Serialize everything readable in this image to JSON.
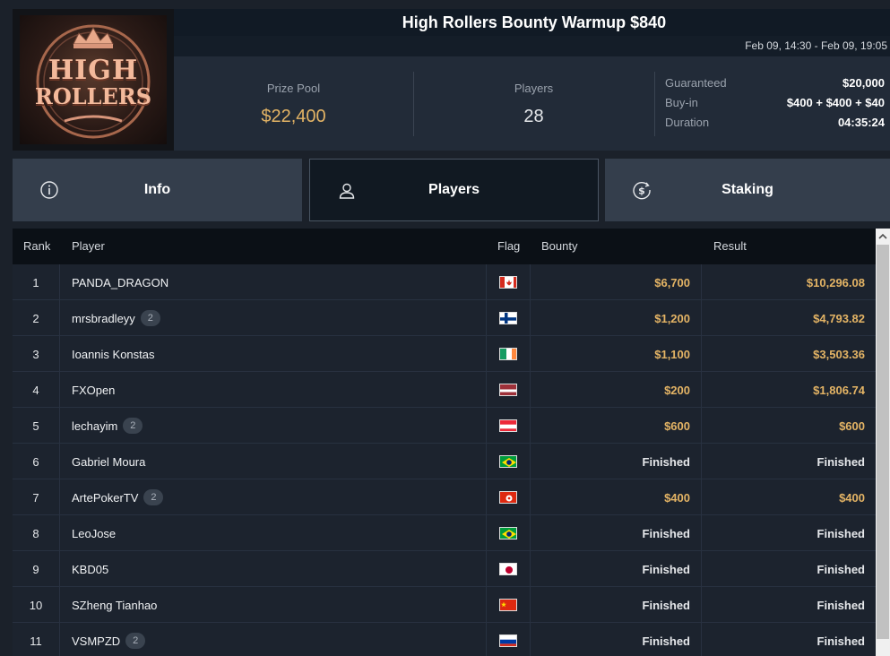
{
  "header": {
    "title": "High Rollers Bounty Warmup $840",
    "dates": "Feb 09, 14:30 - Feb 09, 19:05",
    "logo_text_line1": "HIGH",
    "logo_text_line2": "ROLLERS"
  },
  "stats": {
    "prize_pool_label": "Prize Pool",
    "prize_pool_value": "$22,400",
    "players_label": "Players",
    "players_value": "28",
    "guaranteed_label": "Guaranteed",
    "guaranteed_value": "$20,000",
    "buyin_label": "Buy-in",
    "buyin_value": "$400 + $400 + $40",
    "duration_label": "Duration",
    "duration_value": "04:35:24"
  },
  "tabs": [
    {
      "label": "Info",
      "icon": "info-icon"
    },
    {
      "label": "Players",
      "icon": "user-icon"
    },
    {
      "label": "Staking",
      "icon": "dollar-icon"
    }
  ],
  "table": {
    "headers": {
      "rank": "Rank",
      "player": "Player",
      "flag": "Flag",
      "bounty": "Bounty",
      "result": "Result"
    },
    "rows": [
      {
        "rank": "1",
        "player": "PANDA_DRAGON",
        "badge": "",
        "flag": "canada",
        "bounty": "$6,700",
        "result": "$10,296.08"
      },
      {
        "rank": "2",
        "player": "mrsbradleyy",
        "badge": "2",
        "flag": "finland",
        "bounty": "$1,200",
        "result": "$4,793.82"
      },
      {
        "rank": "3",
        "player": "Ioannis Konstas",
        "badge": "",
        "flag": "ireland",
        "bounty": "$1,100",
        "result": "$3,503.36"
      },
      {
        "rank": "4",
        "player": "FXOpen",
        "badge": "",
        "flag": "latvia",
        "bounty": "$200",
        "result": "$1,806.74"
      },
      {
        "rank": "5",
        "player": "lechayim",
        "badge": "2",
        "flag": "austria",
        "bounty": "$600",
        "result": "$600"
      },
      {
        "rank": "6",
        "player": "Gabriel Moura",
        "badge": "",
        "flag": "brazil",
        "bounty": "Finished",
        "result": "Finished"
      },
      {
        "rank": "7",
        "player": "ArtePokerTV",
        "badge": "2",
        "flag": "hongkong",
        "bounty": "$400",
        "result": "$400"
      },
      {
        "rank": "8",
        "player": "LeoJose",
        "badge": "",
        "flag": "brazil",
        "bounty": "Finished",
        "result": "Finished"
      },
      {
        "rank": "9",
        "player": "KBD05",
        "badge": "",
        "flag": "japan",
        "bounty": "Finished",
        "result": "Finished"
      },
      {
        "rank": "10",
        "player": "SZheng Tianhao",
        "badge": "",
        "flag": "china",
        "bounty": "Finished",
        "result": "Finished"
      },
      {
        "rank": "11",
        "player": "VSMPZD",
        "badge": "2",
        "flag": "russia",
        "bounty": "Finished",
        "result": "Finished"
      }
    ]
  },
  "colors": {
    "gold": "#e4b465",
    "background": "#1b212a",
    "row": "#1c232e",
    "header": "#0b1016"
  }
}
